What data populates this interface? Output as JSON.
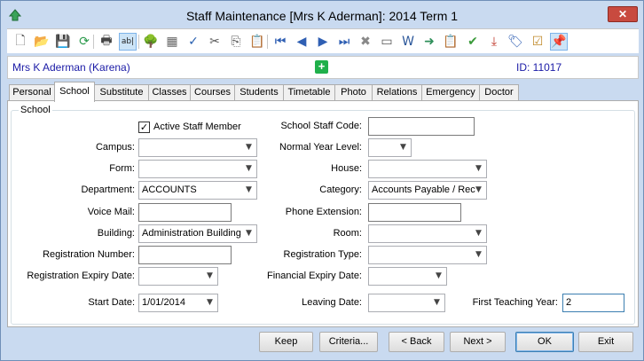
{
  "window": {
    "title": "Staff Maintenance  [Mrs K Aderman]: 2014 Term 1",
    "close_label": "✕"
  },
  "toolbar": {
    "buttons": [
      {
        "name": "new-icon",
        "glyph": "🗋"
      },
      {
        "name": "open-folder-icon",
        "glyph": "📂"
      },
      {
        "name": "save-icon",
        "glyph": "💾"
      },
      {
        "name": "refresh-icon",
        "glyph": "⟳"
      },
      {
        "name": "print-icon",
        "glyph": "🖶"
      },
      {
        "name": "text-field-icon",
        "glyph": "ab|"
      },
      {
        "name": "tree-icon",
        "glyph": "🌳"
      },
      {
        "name": "calculator-icon",
        "glyph": "▦"
      },
      {
        "name": "spellcheck-icon",
        "glyph": "✓"
      },
      {
        "name": "cut-icon",
        "glyph": "✂"
      },
      {
        "name": "copy-icon",
        "glyph": "⎘"
      },
      {
        "name": "paste-icon",
        "glyph": "📋"
      },
      {
        "name": "first-record-icon",
        "glyph": "⏮"
      },
      {
        "name": "previous-record-icon",
        "glyph": "◀"
      },
      {
        "name": "next-record-icon",
        "glyph": "▶"
      },
      {
        "name": "last-record-icon",
        "glyph": "⏭"
      },
      {
        "name": "delete-icon",
        "glyph": "✖"
      },
      {
        "name": "card-icon",
        "glyph": "▭"
      },
      {
        "name": "word-icon",
        "glyph": "W"
      },
      {
        "name": "send-icon",
        "glyph": "➜"
      },
      {
        "name": "clipboard-calc-icon",
        "glyph": "📋"
      },
      {
        "name": "clipboard-check-icon",
        "glyph": "✔"
      },
      {
        "name": "download-tray-icon",
        "glyph": "⤓"
      },
      {
        "name": "tag-icon",
        "glyph": "🏷"
      },
      {
        "name": "task-icon",
        "glyph": "☑"
      },
      {
        "name": "pin-icon",
        "glyph": "📌"
      }
    ]
  },
  "infobar": {
    "staff_name": "Mrs K Aderman (Karena)",
    "add_glyph": "+",
    "id_label": "ID: 11017"
  },
  "tabs": [
    "Personal",
    "School",
    "Substitute",
    "Classes",
    "Courses",
    "Students",
    "Timetable",
    "Photo",
    "Relations",
    "Emergency",
    "Doctor"
  ],
  "active_tab": "School",
  "school": {
    "group_title": "School",
    "active_staff_label": "Active Staff Member",
    "active_staff_checked": true,
    "check_glyph": "✓",
    "dropdown_glyph": "▼",
    "campus_label": "Campus:",
    "campus_value": "",
    "form_label": "Form:",
    "form_value": "",
    "department_label": "Department:",
    "department_value": "ACCOUNTS",
    "voicemail_label": "Voice Mail:",
    "voicemail_value": "",
    "building_label": "Building:",
    "building_value": "Administration Building",
    "registration_number_label": "Registration Number:",
    "registration_number_value": "",
    "registration_expiry_label": "Registration Expiry Date:",
    "registration_expiry_value": "",
    "start_date_label": "Start Date:",
    "start_date_value": "1/01/2014",
    "school_staff_code_label": "School Staff Code:",
    "school_staff_code_value": "",
    "normal_year_level_label": "Normal Year Level:",
    "normal_year_level_value": "",
    "house_label": "House:",
    "house_value": "",
    "category_label": "Category:",
    "category_value": "Accounts Payable / Rec",
    "phone_extension_label": "Phone Extension:",
    "phone_extension_value": "",
    "room_label": "Room:",
    "room_value": "",
    "registration_type_label": "Registration Type:",
    "registration_type_value": "",
    "financial_expiry_label": "Financial Expiry Date:",
    "financial_expiry_value": "",
    "leaving_date_label": "Leaving Date:",
    "leaving_date_value": "",
    "first_teaching_year_label": "First Teaching Year:",
    "first_teaching_year_value": "2"
  },
  "buttons": {
    "keep": "Keep",
    "criteria": "Criteria...",
    "back": "< Back",
    "next": "Next >",
    "ok": "OK",
    "exit": "Exit"
  }
}
